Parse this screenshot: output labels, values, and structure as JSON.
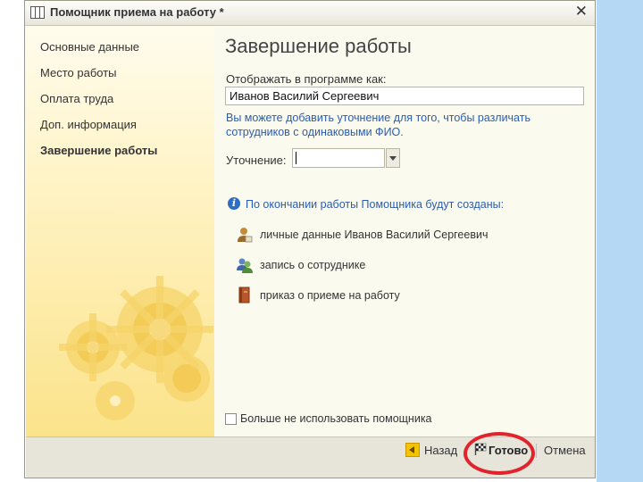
{
  "window": {
    "title": "Помощник приема на работу *",
    "title_icon": "table-icon",
    "close_icon": "close-icon",
    "close_glyph": "✕"
  },
  "sidebar": {
    "items": [
      {
        "label": "Основные данные",
        "active": false
      },
      {
        "label": "Место работы",
        "active": false
      },
      {
        "label": "Оплата труда",
        "active": false
      },
      {
        "label": "Доп. информация",
        "active": false
      },
      {
        "label": "Завершение работы",
        "active": true
      }
    ]
  },
  "main": {
    "title": "Завершение работы",
    "display_label": "Отображать в программе как:",
    "display_value": "Иванов Василий Сергеевич",
    "hint": "Вы можете добавить уточнение для того, чтобы различать сотрудников с одинаковыми ФИО.",
    "clarification_label": "Уточнение:",
    "clarification_value": "",
    "info_icon": "info-icon",
    "info_glyph": "i",
    "info_text": "По окончании работы Помощника будут созданы:",
    "results": [
      {
        "icon": "person-icon",
        "label": "личные данные Иванов Василий Сергеевич"
      },
      {
        "icon": "employee-record-icon",
        "label": "запись о сотруднике"
      },
      {
        "icon": "order-book-icon",
        "label": "приказ о приеме на работу"
      }
    ],
    "dont_use_label": "Больше не использовать помощника",
    "dont_use_checked": false
  },
  "footer": {
    "back_label": "Назад",
    "back_icon": "back-arrow-icon",
    "finish_label": "Готово",
    "finish_icon": "checkered-flag-icon",
    "cancel_label": "Отмена"
  },
  "colors": {
    "accent_blue": "#2a5db0",
    "highlight_red": "#e0232d",
    "sidebar_yellow": "#fbe38a",
    "page_bg_blue": "#b5d9f4"
  }
}
